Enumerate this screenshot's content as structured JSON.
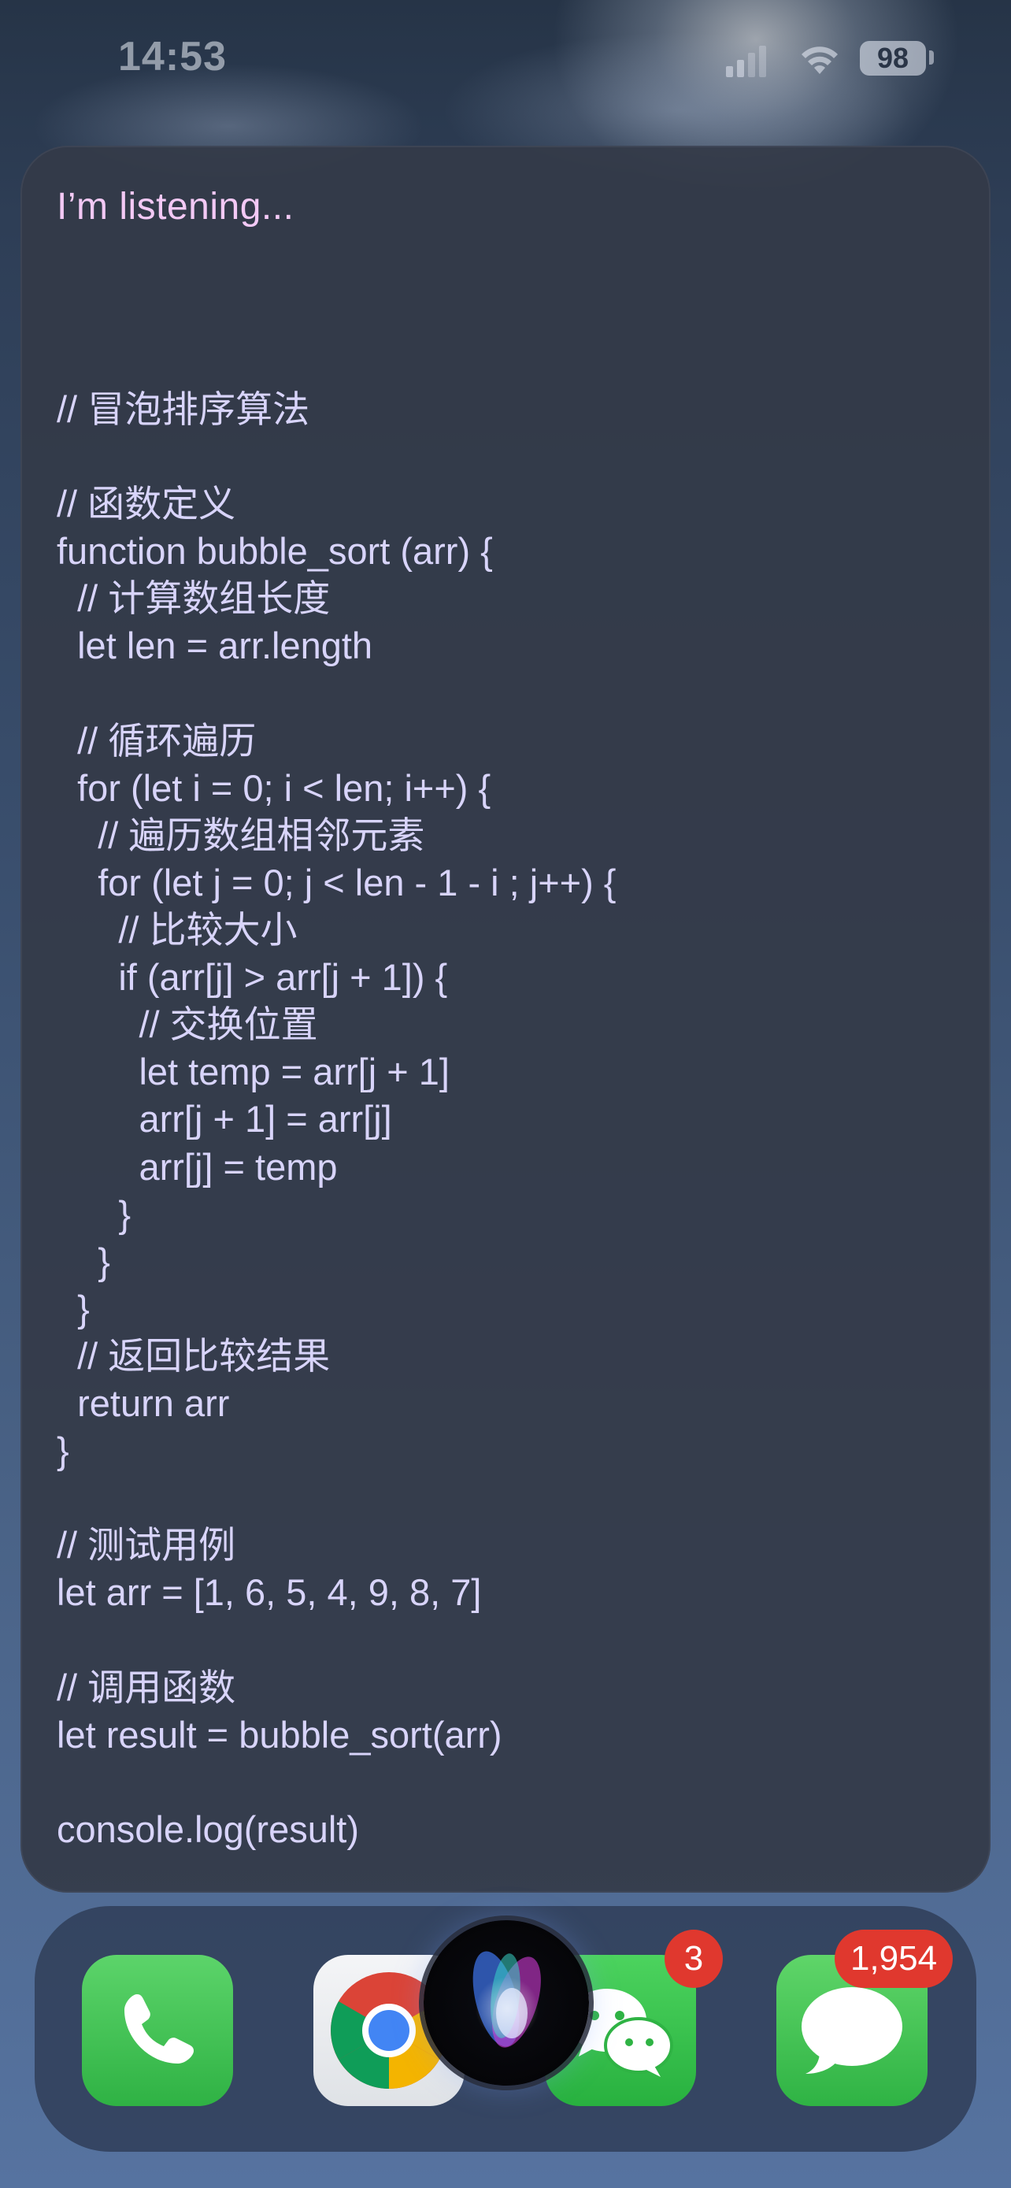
{
  "status_bar": {
    "time": "14:53",
    "battery": "98",
    "icons": [
      "cellular-signal-icon",
      "wifi-icon",
      "battery-icon"
    ]
  },
  "siri": {
    "status": "I’m listening...",
    "code_lines": [
      "// 冒泡排序算法",
      "",
      "// 函数定义",
      "function bubble_sort (arr) {",
      "  // 计算数组长度",
      "  let len = arr.length",
      "",
      "  // 循环遍历",
      "  for (let i = 0; i < len; i++) {",
      "    // 遍历数组相邻元素",
      "    for (let j = 0; j < len - 1 - i ; j++) {",
      "      // 比较大小",
      "      if (arr[j] > arr[j + 1]) {",
      "        // 交换位置",
      "        let temp = arr[j + 1]",
      "        arr[j + 1] = arr[j]",
      "        arr[j] = temp",
      "      }",
      "    }",
      "  }",
      "  // 返回比较结果",
      "  return arr",
      "}",
      "",
      "// 测试用例",
      "let arr = [1, 6, 5, 4, 9, 8, 7]",
      "",
      "// 调用函数",
      "let result = bubble_sort(arr)",
      "",
      "console.log(result)"
    ]
  },
  "dock": {
    "apps": [
      {
        "name": "Phone",
        "icon": "phone-icon",
        "badge": ""
      },
      {
        "name": "Chrome",
        "icon": "chrome-icon",
        "badge": ""
      },
      {
        "name": "WeChat",
        "icon": "wechat-icon",
        "badge": "3"
      },
      {
        "name": "Messages",
        "icon": "messages-icon",
        "badge": "1,954"
      }
    ]
  },
  "colors": {
    "siri_status": "#f3c9f5",
    "code_text": "#d8d4fa",
    "card_background": "#343a48",
    "badge": "#e0382e",
    "dock_green": "#34c759"
  }
}
